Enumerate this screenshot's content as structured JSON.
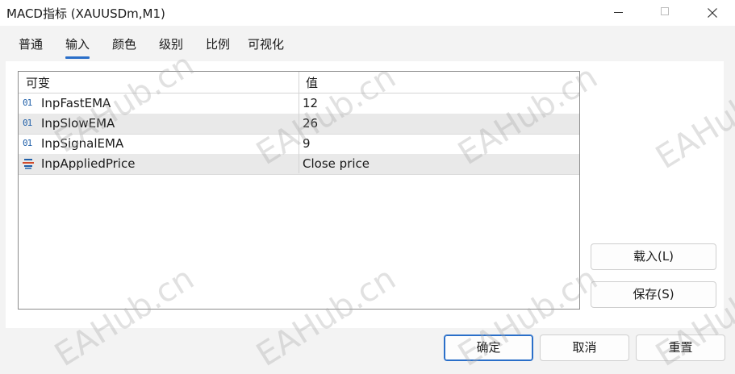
{
  "window": {
    "title": "MACD指标 (XAUUSDm,M1)"
  },
  "tabs": [
    {
      "label": "普通"
    },
    {
      "label": "输入",
      "active": true
    },
    {
      "label": "颜色"
    },
    {
      "label": "级别"
    },
    {
      "label": "比例"
    },
    {
      "label": "可视化"
    }
  ],
  "grid": {
    "headers": {
      "variable": "可变",
      "value": "值"
    },
    "rows": [
      {
        "icon": "int-01-icon",
        "icon_text": "01",
        "name": "InpFastEMA",
        "value": "12"
      },
      {
        "icon": "int-01-icon",
        "icon_text": "01",
        "name": "InpSlowEMA",
        "value": "26"
      },
      {
        "icon": "int-01-icon",
        "icon_text": "01",
        "name": "InpSignalEMA",
        "value": "9"
      },
      {
        "icon": "enum-list-icon",
        "name": "InpAppliedPrice",
        "value": "Close price"
      }
    ]
  },
  "side_buttons": {
    "load": "载入(L)",
    "save": "保存(S)"
  },
  "footer_buttons": {
    "ok": "确定",
    "cancel": "取消",
    "reset": "重置"
  },
  "watermark": "EAHub.cn",
  "colors": {
    "accent": "#2a6fc9",
    "icon_blue": "#1f5fa8",
    "alt_row": "#e9e9e9"
  }
}
